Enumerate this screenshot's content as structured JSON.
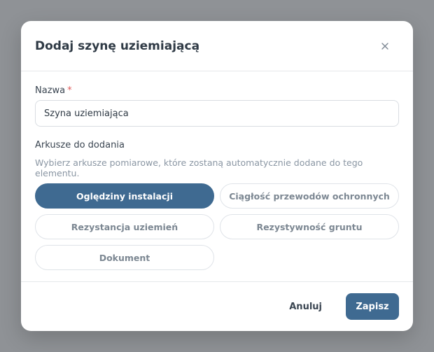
{
  "modal": {
    "title": "Dodaj szynę uziemiającą",
    "close_icon": "close-icon"
  },
  "form": {
    "name_label": "Nazwa",
    "required_mark": "*",
    "name_value": "Szyna uziemiająca",
    "sheets_label": "Arkusze do dodania",
    "sheets_hint": "Wybierz arkusze pomiarowe, które zostaną automatycznie dodane do tego elementu.",
    "sheets": [
      {
        "label": "Oględziny instalacji",
        "selected": true
      },
      {
        "label": "Ciągłość przewodów ochronnych",
        "selected": false
      },
      {
        "label": "Rezystancja uziemień",
        "selected": false
      },
      {
        "label": "Rezystywność gruntu",
        "selected": false
      },
      {
        "label": "Dokument",
        "selected": false
      }
    ]
  },
  "footer": {
    "cancel_label": "Anuluj",
    "save_label": "Zapisz"
  },
  "colors": {
    "primary": "#3f6a91",
    "required": "#e05a5a",
    "overlay": "#8f9296"
  }
}
